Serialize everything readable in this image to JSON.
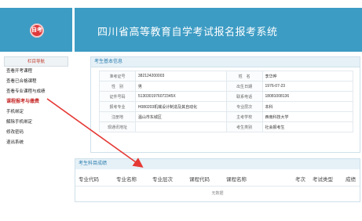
{
  "header": {
    "logo_text": "自考",
    "title": "四川省高等教育自学考试报名报考系统"
  },
  "sidebar": {
    "heading": "栏目导航",
    "items": [
      {
        "label": "查看开考课程"
      },
      {
        "label": "查看已合格课程"
      },
      {
        "label": "查看专业课程与成绩"
      },
      {
        "label": "课程报考与缴费"
      },
      {
        "label": "手机绑定"
      },
      {
        "label": "解除手机绑定"
      },
      {
        "label": "修改密码"
      },
      {
        "label": "退出系统"
      }
    ],
    "active_index": 3
  },
  "info": {
    "heading": "考生基本信息",
    "rows": [
      {
        "l1": "准考证号",
        "v1": "382124200003",
        "l2": "姓　名",
        "v2": "李华哗"
      },
      {
        "l1": "性　别",
        "v1": "男",
        "l2": "出生日期",
        "v2": "1976-07-23"
      },
      {
        "l1": "证件号码",
        "v1": "5130301976072345X",
        "l2": "联系电话",
        "v2": "18081008136"
      },
      {
        "l1": "报考专业",
        "v1": "H080203机械设计制造及其自动化",
        "l2": "专业层次",
        "v2": "本科"
      },
      {
        "l1": "注册地",
        "v1": "温山市东城区",
        "l2": "主考学校",
        "v2": "西南科技大学"
      },
      {
        "l1": "现通讯地址",
        "v1": "",
        "l2": "考生类别",
        "v2": "社会报考生"
      }
    ]
  },
  "grades": {
    "heading": "考生科目成绩",
    "columns": [
      "专业代码",
      "专业名称",
      "专业层次",
      "课程代码",
      "课程名称",
      "考次",
      "考试类型",
      "成绩"
    ],
    "empty_text": "无数据"
  },
  "colors": {
    "header_bg": "#3d9cc4",
    "active_item": "#c62828",
    "arrow": "#e53935"
  }
}
